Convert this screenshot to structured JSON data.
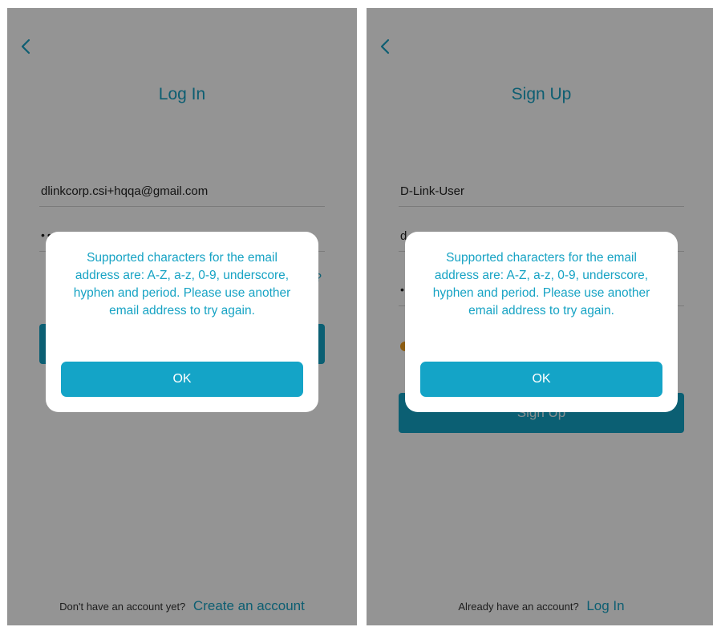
{
  "colors": {
    "accent": "#17a3c4",
    "button": "#14a4c7",
    "overlay": "rgba(0,0,0,0.42)",
    "checkbox": "#f2a122"
  },
  "login_screen": {
    "title": "Log In",
    "email_value": "dlinkcorp.csi+hqqa@gmail.com",
    "password_value": "••••••••",
    "partial_link": "?",
    "login_button_label": "",
    "bottom_text": "Don't have an account yet?",
    "bottom_link": "Create an account",
    "back_icon": "chevron-left-icon"
  },
  "signup_screen": {
    "title": "Sign Up",
    "username_value": "D-Link-User",
    "email_value_partial": "d",
    "password_value": "•",
    "signup_button_label": "Sign Up",
    "bottom_text": "Already have an account?",
    "bottom_link": "Log In",
    "back_icon": "chevron-left-icon"
  },
  "dialog": {
    "message": "Supported characters for the email address are: A-Z, a-z, 0-9, underscore, hyphen and period. Please use another email address to try again.",
    "ok_label": "OK"
  }
}
